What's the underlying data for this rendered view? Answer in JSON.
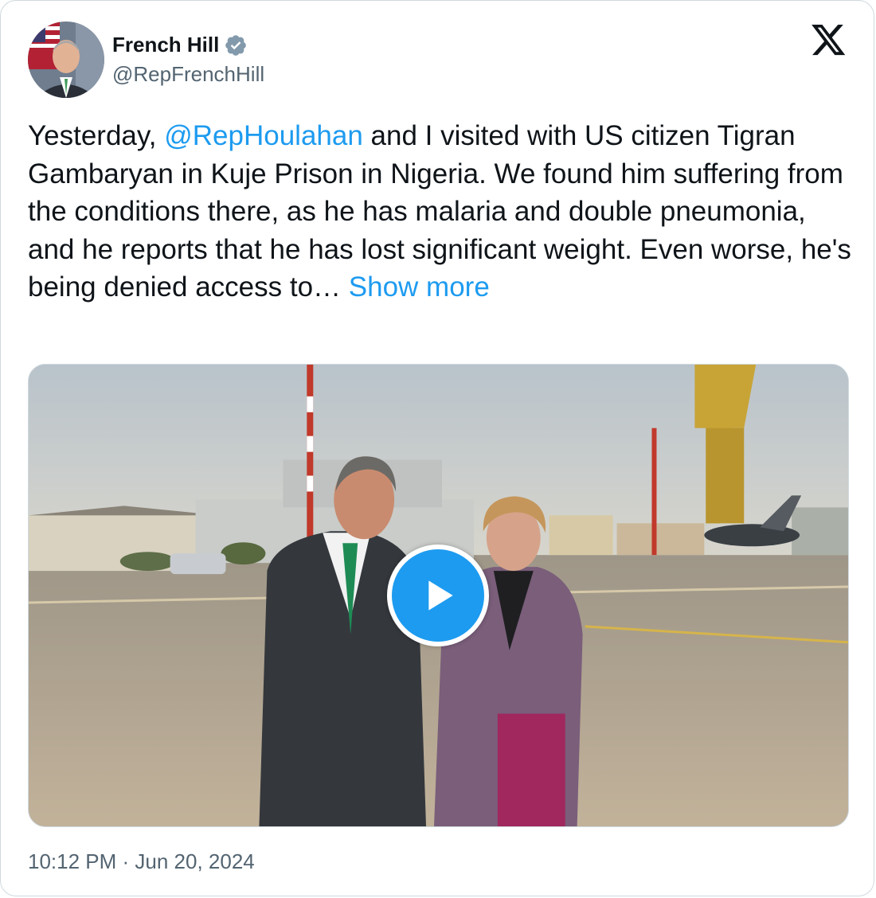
{
  "author": {
    "display_name": "French Hill",
    "handle": "@RepFrenchHill",
    "verified_icon": "verified-badge-icon",
    "avatar_icon": "profile-photo"
  },
  "brand": {
    "logo_icon": "x-logo-icon"
  },
  "tweet": {
    "text_before": "Yesterday, ",
    "mention": "@RepHoulahan",
    "text_after": " and I visited with US citizen Tigran Gambaryan in Kuje Prison in Nigeria. We found him suffering from the conditions there, as he has malaria and double pneumonia, and he reports that he has lost significant weight. Even worse, he's being denied access to… ",
    "show_more": "Show more"
  },
  "media": {
    "type": "video",
    "play_icon": "play-icon"
  },
  "timestamp": "10:12 PM · Jun 20, 2024",
  "colors": {
    "accent": "#1d9bf0",
    "secondary_text": "#536471",
    "border": "#cfd9de"
  }
}
